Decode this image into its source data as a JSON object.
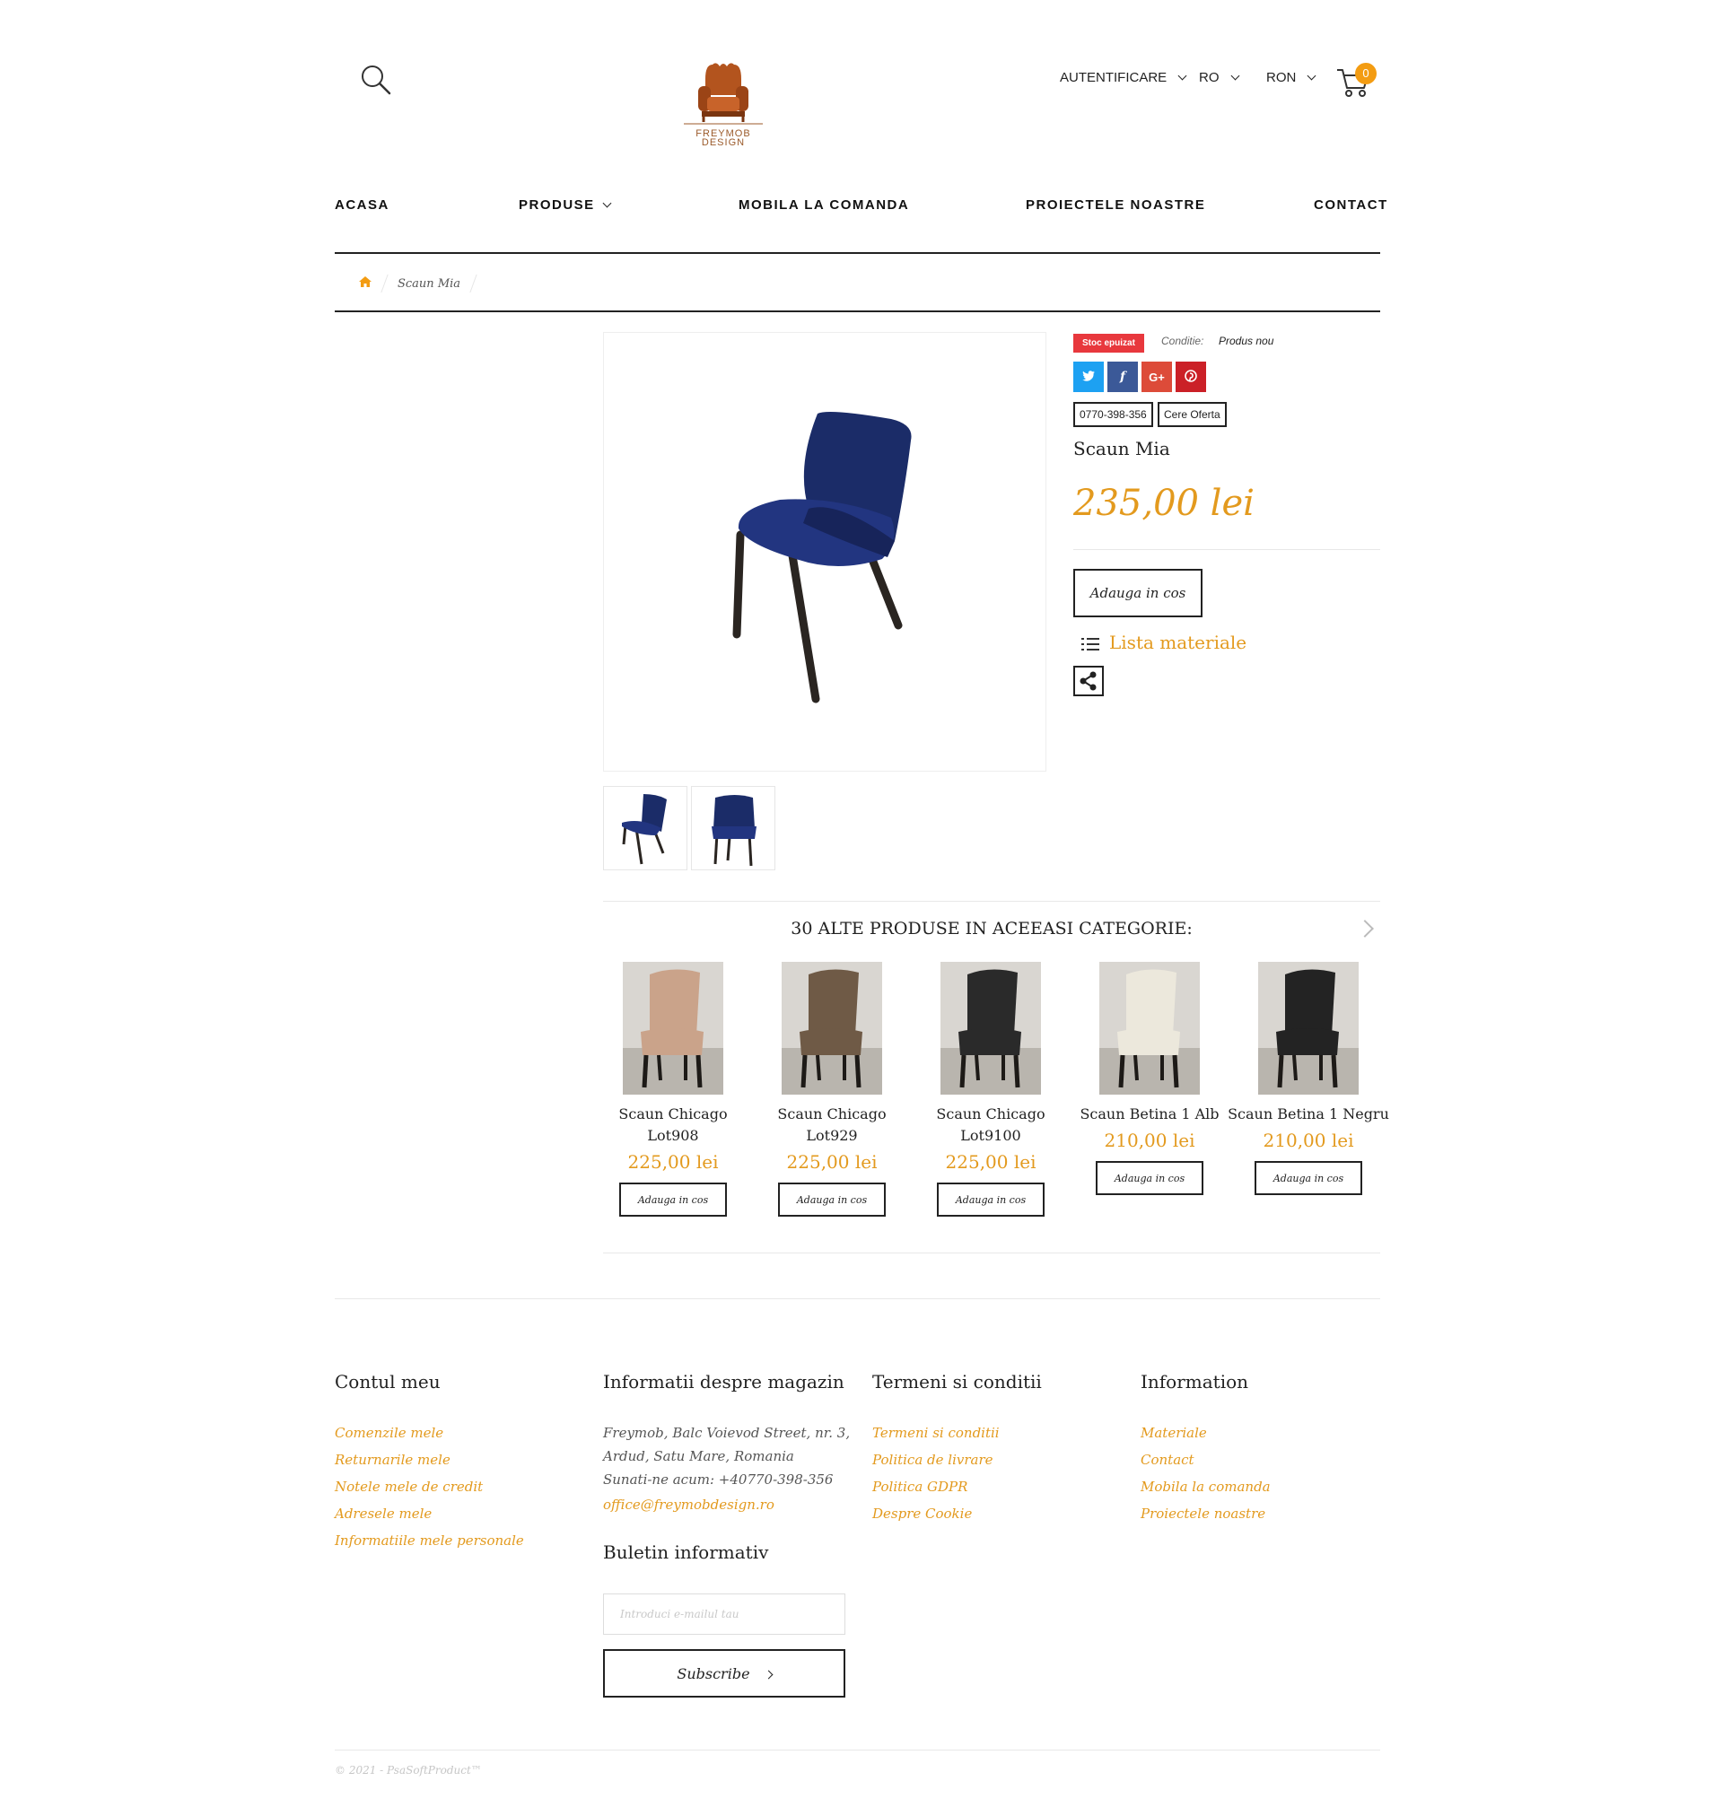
{
  "header": {
    "login_label": "AUTENTIFICARE",
    "language_label": "RO",
    "currency_label": "RON",
    "cart_count": "0",
    "logo_text_1": "FREYMOB",
    "logo_text_2": "DESIGN"
  },
  "nav": {
    "items": [
      "ACASA",
      "PRODUSE",
      "MOBILA LA COMANDA",
      "PROIECTELE NOASTRE",
      "CONTACT"
    ]
  },
  "breadcrumb": {
    "current": "Scaun Mia"
  },
  "product": {
    "stock_badge": "Stoc epuizat",
    "condition_label": "Conditie:",
    "condition_value": "Produs nou",
    "phone_button": "0770-398-356",
    "quote_button": "Cere Oferta",
    "name": "Scaun Mia",
    "price": "235,00 lei",
    "add_to_cart": "Adauga in cos",
    "materials_label": "Lista materiale",
    "social_icons": [
      "twitter-icon",
      "facebook-icon",
      "google-plus-icon",
      "pinterest-icon"
    ]
  },
  "related": {
    "title": "30 ALTE PRODUSE IN ACEEASI CATEGORIE:",
    "products": [
      {
        "name_line1": "Scaun Chicago",
        "name_line2": "Lot908",
        "price": "225,00 lei",
        "button": "Adauga in cos",
        "color": "#caa38a"
      },
      {
        "name_line1": "Scaun Chicago",
        "name_line2": "Lot929",
        "price": "225,00 lei",
        "button": "Adauga in cos",
        "color": "#6f5a46"
      },
      {
        "name_line1": "Scaun Chicago",
        "name_line2": "Lot9100",
        "price": "225,00 lei",
        "button": "Adauga in cos",
        "color": "#2a2a2a"
      },
      {
        "name_line1": "Scaun Betina 1 Alb",
        "name_line2": "",
        "price": "210,00 lei",
        "button": "Adauga in cos",
        "color": "#ece8dc"
      },
      {
        "name_line1": "Scaun Betina 1 Negru",
        "name_line2": "",
        "price": "210,00 lei",
        "button": "Adauga in cos",
        "color": "#232323"
      }
    ]
  },
  "footer": {
    "account": {
      "title": "Contul meu",
      "links": [
        "Comenzile mele",
        "Returnarile mele",
        "Notele mele de credit",
        "Adresele mele",
        "Informatiile mele personale"
      ]
    },
    "store": {
      "title": "Informatii despre magazin",
      "address_line1": "Freymob, Balc Voievod Street, nr. 3,",
      "address_line2": "Ardud, Satu Mare, Romania",
      "phone_line": "Sunati-ne acum: +40770-398-356",
      "email": "office@freymobdesign.ro"
    },
    "newsletter": {
      "title": "Buletin informativ",
      "placeholder": "Introduci e-mailul tau",
      "button": "Subscribe"
    },
    "terms": {
      "title": "Termeni si conditii",
      "links": [
        "Termeni si conditii",
        "Politica de livrare",
        "Politica GDPR",
        "Despre Cookie"
      ]
    },
    "information": {
      "title": "Information",
      "links": [
        "Materiale",
        "Contact",
        "Mobila la comanda",
        "Proiectele noastre"
      ]
    },
    "copyright": "© 2021 - PsaSoftProduct™"
  },
  "colors": {
    "accent": "#e39a1e",
    "badge": "#f39c12",
    "stock_red": "#e8383d",
    "twitter": "#1da1f2",
    "facebook": "#3b5998",
    "google": "#dd4b39",
    "pinterest": "#cb2027"
  }
}
